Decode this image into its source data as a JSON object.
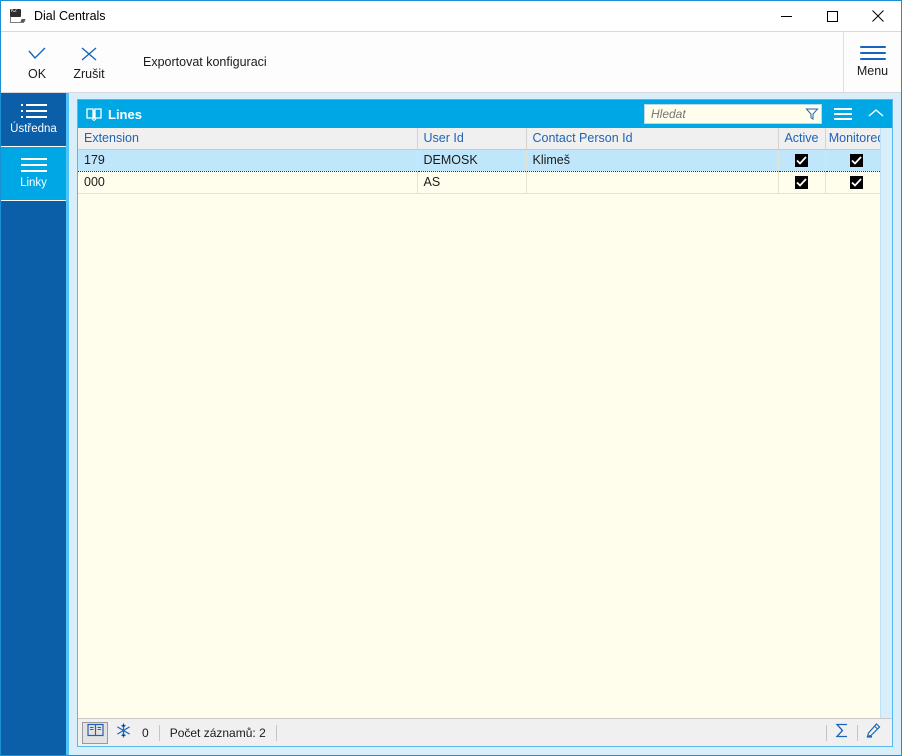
{
  "window": {
    "title": "Dial Centrals",
    "icon": "k2-app-icon",
    "controls": {
      "minimize": "minimize-icon",
      "maximize": "maximize-icon",
      "close": "close-icon"
    }
  },
  "ribbon": {
    "ok_label": "OK",
    "ok_icon": "check-icon",
    "cancel_label": "Zrušit",
    "cancel_icon": "x-icon",
    "export_label": "Exportovat konfiguraci",
    "menu_label": "Menu",
    "menu_icon": "hamburger-icon"
  },
  "sidebar": {
    "items": [
      {
        "label": "Ústředna",
        "icon": "bulleted-list-icon",
        "active": false
      },
      {
        "label": "Linky",
        "icon": "list-icon",
        "active": true
      }
    ]
  },
  "panel": {
    "title": "Lines",
    "icon": "book-icon",
    "search": {
      "value": "",
      "placeholder": "Hledat",
      "filter_icon": "funnel-icon"
    },
    "menu_icon": "hamburger-icon",
    "collapse_icon": "chevron-up-icon"
  },
  "grid": {
    "columns": [
      {
        "key": "extension",
        "label": "Extension",
        "align": "left"
      },
      {
        "key": "user_id",
        "label": "User Id",
        "align": "left"
      },
      {
        "key": "contact_person_id",
        "label": "Contact Person Id",
        "align": "left"
      },
      {
        "key": "active",
        "label": "Active",
        "align": "center"
      },
      {
        "key": "monitored",
        "label": "Monitored",
        "align": "center"
      }
    ],
    "rows": [
      {
        "extension": "179",
        "user_id": "DEMOSK",
        "contact_person_id": "Klimeš",
        "active": true,
        "monitored": true,
        "selected": true
      },
      {
        "extension": "000",
        "user_id": "AS",
        "contact_person_id": "",
        "active": true,
        "monitored": true,
        "selected": false
      }
    ]
  },
  "statusbar": {
    "book_icon": "book-icon",
    "snowflake_icon": "snowflake-icon",
    "count_value": "0",
    "record_count_label": "Počet záznamů: 2",
    "sum_icon": "sigma-icon",
    "edit_icon": "pencil-icon"
  },
  "colors": {
    "accent_blue": "#00a7e5",
    "sidebar_blue": "#0b5ea8",
    "content_bg": "#d9eefb",
    "grid_bg": "#fffeed",
    "row_selected": "#bfe6fa",
    "header_text": "#1f63b5",
    "icon_blue": "#1565c0",
    "window_border": "#1b8fd4"
  }
}
